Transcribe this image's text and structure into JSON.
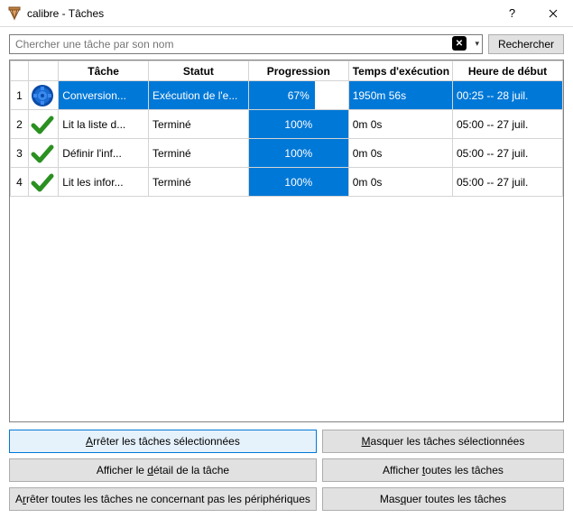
{
  "window": {
    "title": "calibre - Tâches"
  },
  "search": {
    "placeholder": "Chercher une tâche par son nom",
    "button": "Rechercher"
  },
  "columns": {
    "task": "Tâche",
    "status": "Statut",
    "progress": "Progression",
    "runtime": "Temps d'exécution",
    "start": "Heure de début"
  },
  "rows": [
    {
      "n": "1",
      "icon": "gear",
      "task": "Conversion...",
      "status": "Exécution de l'e...",
      "progress_pct": 67,
      "progress_label": "67%",
      "runtime": "1950m 56s",
      "start": "00:25 -- 28 juil.",
      "selected": true
    },
    {
      "n": "2",
      "icon": "check",
      "task": "Lit la liste d...",
      "status": "Terminé",
      "progress_pct": 100,
      "progress_label": "100%",
      "runtime": "0m 0s",
      "start": "05:00 -- 27 juil.",
      "selected": false
    },
    {
      "n": "3",
      "icon": "check",
      "task": "Définir l'inf...",
      "status": "Terminé",
      "progress_pct": 100,
      "progress_label": "100%",
      "runtime": "0m 0s",
      "start": "05:00 -- 27 juil.",
      "selected": false
    },
    {
      "n": "4",
      "icon": "check",
      "task": "Lit les infor...",
      "status": "Terminé",
      "progress_pct": 100,
      "progress_label": "100%",
      "runtime": "0m 0s",
      "start": "05:00 -- 27 juil.",
      "selected": false
    }
  ],
  "buttons": {
    "stop_selected": {
      "pre": "",
      "u": "A",
      "post": "rrêter les tâches sélectionnées"
    },
    "hide_selected": {
      "pre": "",
      "u": "M",
      "post": "asquer les tâches sélectionnées"
    },
    "show_detail": {
      "pre": "Afficher le ",
      "u": "d",
      "post": "étail de la tâche"
    },
    "show_all": {
      "pre": "Afficher ",
      "u": "t",
      "post": "outes les tâches"
    },
    "stop_nondev": {
      "pre": "A",
      "u": "r",
      "post": "rêter toutes les tâches ne concernant pas les périphériques"
    },
    "hide_all": {
      "pre": "Mas",
      "u": "q",
      "post": "uer toutes les tâches"
    }
  }
}
